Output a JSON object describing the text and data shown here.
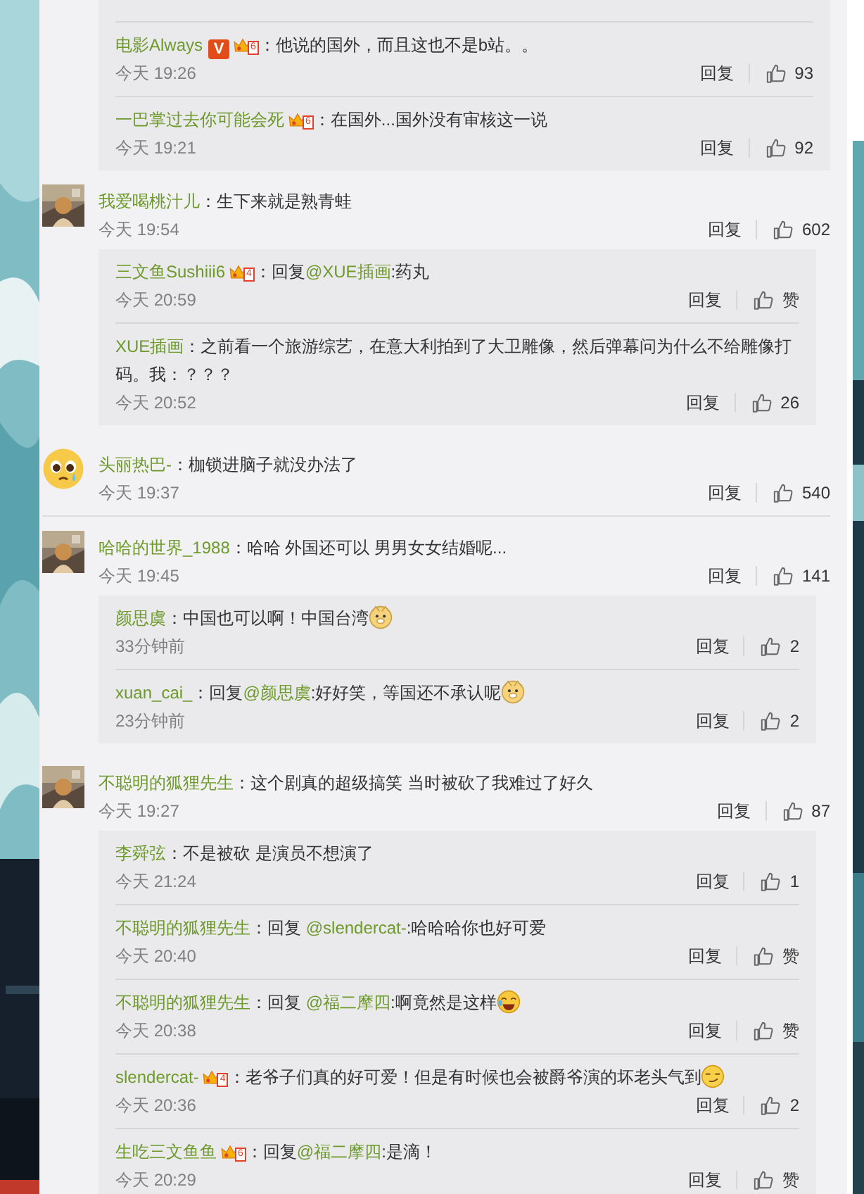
{
  "thread": [
    {
      "kind": "continuation",
      "replies": [
        {
          "user": "电影Always",
          "badges": [
            {
              "kind": "verified",
              "label": "V"
            },
            {
              "kind": "crown",
              "label": "6"
            }
          ],
          "parts": [
            {
              "kind": "plain",
              "text": "：他说的国外，而且这也不是b站。。"
            }
          ],
          "time": "今天 19:26",
          "reply": "回复",
          "likes": "93"
        },
        {
          "user": "一巴掌过去你可能会死",
          "badges": [
            {
              "kind": "crown",
              "label": "6"
            }
          ],
          "parts": [
            {
              "kind": "plain",
              "text": "：在国外...国外没有审核这一说"
            }
          ],
          "time": "今天 19:21",
          "reply": "回复",
          "likes": "92"
        }
      ]
    },
    {
      "kind": "comment",
      "avatar": {
        "kind": "picture"
      },
      "user": "我爱喝桃汁儿",
      "parts": [
        {
          "kind": "plain",
          "text": "：生下来就是熟青蛙"
        }
      ],
      "time": "今天 19:54",
      "reply": "回复",
      "likes": "602",
      "replies": [
        {
          "user": "三文鱼Sushiii6",
          "badges": [
            {
              "kind": "crown",
              "label": "4"
            }
          ],
          "parts": [
            {
              "kind": "plain",
              "text": "：回复"
            },
            {
              "kind": "mention",
              "text": "@XUE插画"
            },
            {
              "kind": "plain",
              "text": ":药丸"
            }
          ],
          "time": "今天 20:59",
          "reply": "回复",
          "likes": "赞"
        },
        {
          "user": "XUE插画",
          "parts": [
            {
              "kind": "plain",
              "text": "：之前看一个旅游综艺，在意大利拍到了大卫雕像，然后弹幕问为什么不给雕像打码。我：？？？"
            }
          ],
          "time": "今天 20:52",
          "reply": "回复",
          "likes": "26"
        }
      ]
    },
    {
      "kind": "comment",
      "avatar": {
        "kind": "emoji"
      },
      "user": "头丽热巴-",
      "parts": [
        {
          "kind": "plain",
          "text": "：枷锁进脑子就没办法了"
        }
      ],
      "time": "今天 19:37",
      "reply": "回复",
      "likes": "540"
    },
    {
      "kind": "comment",
      "avatar": {
        "kind": "picture"
      },
      "user": "哈哈的世界_1988",
      "parts": [
        {
          "kind": "plain",
          "text": "：哈哈 外国还可以 男男女女结婚呢..."
        }
      ],
      "time": "今天 19:45",
      "reply": "回复",
      "likes": "141",
      "replies": [
        {
          "user": "颜思虞",
          "parts": [
            {
              "kind": "plain",
              "text": "：中国也可以啊！中国台湾"
            },
            {
              "kind": "doge"
            }
          ],
          "time": "33分钟前",
          "reply": "回复",
          "likes": "2"
        },
        {
          "user": "xuan_cai_",
          "parts": [
            {
              "kind": "plain",
              "text": "：回复"
            },
            {
              "kind": "mention",
              "text": "@颜思虞"
            },
            {
              "kind": "plain",
              "text": ":好好笑，等国还不承认呢"
            },
            {
              "kind": "doge"
            }
          ],
          "time": "23分钟前",
          "reply": "回复",
          "likes": "2"
        }
      ]
    },
    {
      "kind": "comment",
      "avatar": {
        "kind": "picture"
      },
      "user": "不聪明的狐狸先生",
      "parts": [
        {
          "kind": "plain",
          "text": "：这个剧真的超级搞笑 当时被砍了我难过了好久"
        }
      ],
      "time": "今天 19:27",
      "reply": "回复",
      "likes": "87",
      "replies": [
        {
          "user": "李舜弦",
          "parts": [
            {
              "kind": "plain",
              "text": "：不是被砍 是演员不想演了"
            }
          ],
          "time": "今天 21:24",
          "reply": "回复",
          "likes": "1"
        },
        {
          "user": "不聪明的狐狸先生",
          "parts": [
            {
              "kind": "plain",
              "text": "：回复 "
            },
            {
              "kind": "mention",
              "text": "@slendercat-"
            },
            {
              "kind": "plain",
              "text": ":哈哈哈你也好可爱"
            }
          ],
          "time": "今天 20:40",
          "reply": "回复",
          "likes": "赞"
        },
        {
          "user": "不聪明的狐狸先生",
          "parts": [
            {
              "kind": "plain",
              "text": "：回复 "
            },
            {
              "kind": "mention",
              "text": "@福二摩四"
            },
            {
              "kind": "plain",
              "text": ":啊竟然是这样"
            },
            {
              "kind": "laugh"
            }
          ],
          "time": "今天 20:38",
          "reply": "回复",
          "likes": "赞"
        },
        {
          "user": "slendercat-",
          "badges": [
            {
              "kind": "crown",
              "label": "4"
            }
          ],
          "parts": [
            {
              "kind": "plain",
              "text": "：老爷子们真的好可爱！但是有时候也会被爵爷演的坏老头气到"
            },
            {
              "kind": "smirk"
            }
          ],
          "time": "今天 20:36",
          "reply": "回复",
          "likes": "2"
        },
        {
          "user": "生吃三文鱼鱼",
          "badges": [
            {
              "kind": "crown",
              "label": "6"
            }
          ],
          "parts": [
            {
              "kind": "plain",
              "text": "：回复"
            },
            {
              "kind": "mention",
              "text": "@福二摩四"
            },
            {
              "kind": "plain",
              "text": ":是滴！"
            }
          ],
          "time": "今天 20:29",
          "reply": "回复",
          "likes": "赞"
        }
      ]
    }
  ]
}
